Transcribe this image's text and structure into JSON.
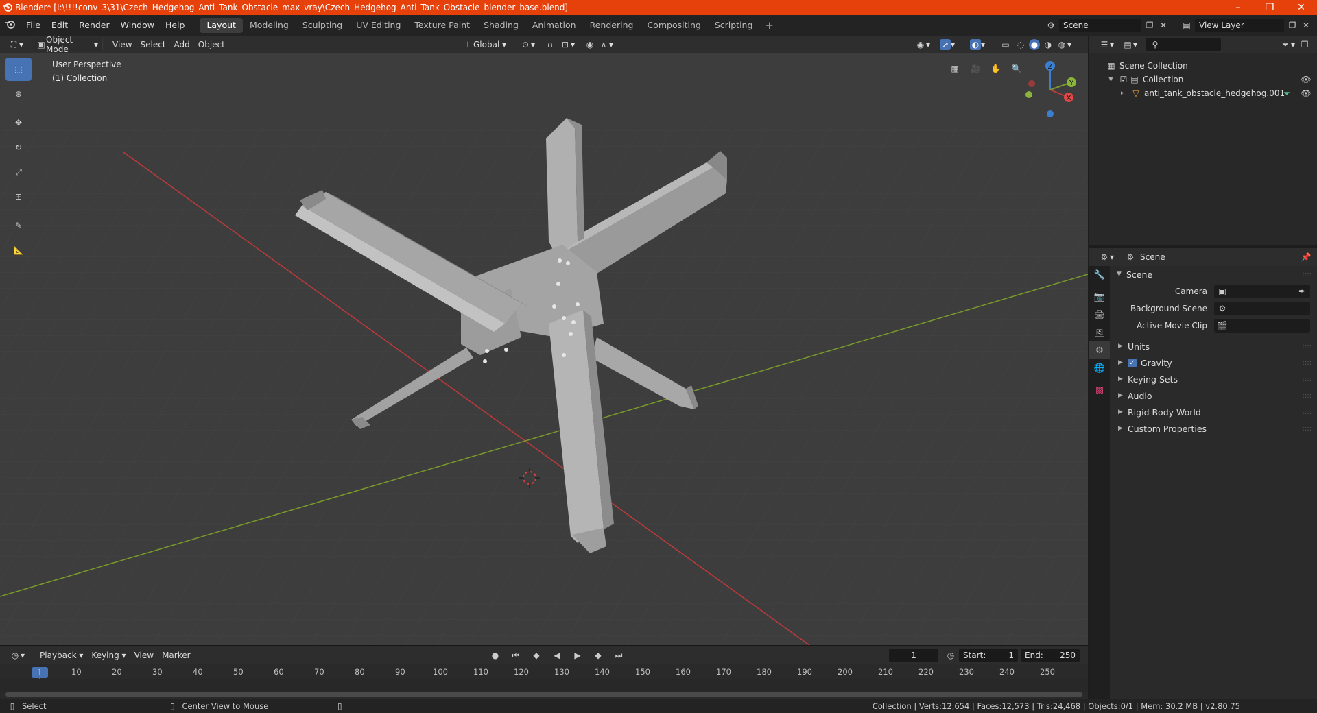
{
  "window": {
    "title": "Blender* [I:\\!!!!conv_3\\31\\Czech_Hedgehog_Anti_Tank_Obstacle_max_vray\\Czech_Hedgehog_Anti_Tank_Obstacle_blender_base.blend]",
    "controls": [
      "–",
      "❐",
      "✕"
    ]
  },
  "menu": [
    "File",
    "Edit",
    "Render",
    "Window",
    "Help"
  ],
  "workspaces": [
    "Layout",
    "Modeling",
    "Sculpting",
    "UV Editing",
    "Texture Paint",
    "Shading",
    "Animation",
    "Rendering",
    "Compositing",
    "Scripting"
  ],
  "active_workspace": "Layout",
  "scene_selector": "Scene",
  "view_layer_selector": "View Layer",
  "viewport_header": {
    "mode": "Object Mode",
    "menus": [
      "View",
      "Select",
      "Add",
      "Object"
    ],
    "transform_orientation": "Global"
  },
  "viewport": {
    "perspective": "User Perspective",
    "collection": "(1) Collection",
    "gizmo_axes": [
      "X",
      "Y",
      "Z"
    ]
  },
  "timeline": {
    "menus": [
      "Playback",
      "Keying",
      "View",
      "Marker"
    ],
    "current_frame": "1",
    "start_label": "Start:",
    "start": "1",
    "end_label": "End:",
    "end": "250",
    "ruler": [
      "1",
      "10",
      "20",
      "30",
      "40",
      "50",
      "60",
      "70",
      "80",
      "90",
      "100",
      "110",
      "120",
      "130",
      "140",
      "150",
      "160",
      "170",
      "180",
      "190",
      "200",
      "210",
      "220",
      "230",
      "240",
      "250"
    ]
  },
  "status": {
    "left_action": "Select",
    "mid_action": "Center View to Mouse",
    "right": "Collection | Verts:12,654 | Faces:12,573 | Tris:24,468 | Objects:0/1 | Mem: 30.2 MB | v2.80.75"
  },
  "outliner": {
    "root": "Scene Collection",
    "collection": "Collection",
    "object": "anti_tank_obstacle_hedgehog.001"
  },
  "properties": {
    "context": "Scene",
    "panel": "Scene",
    "camera_label": "Camera",
    "camera_value": "",
    "background_label": "Background Scene",
    "background_value": "",
    "clip_label": "Active Movie Clip",
    "clip_value": "",
    "subpanels": [
      {
        "label": "Units",
        "checkbox": false
      },
      {
        "label": "Gravity",
        "checkbox": true
      },
      {
        "label": "Keying Sets",
        "checkbox": false
      },
      {
        "label": "Audio",
        "checkbox": false
      },
      {
        "label": "Rigid Body World",
        "checkbox": false
      },
      {
        "label": "Custom Properties",
        "checkbox": false
      }
    ]
  },
  "colors": {
    "titlebar": "#e6410b",
    "accent": "#4772b3",
    "x_axis": "#c0393b",
    "y_axis": "#7a9a2a",
    "z_axis": "#3b7fd0",
    "mesh": "#a9a9a9"
  }
}
